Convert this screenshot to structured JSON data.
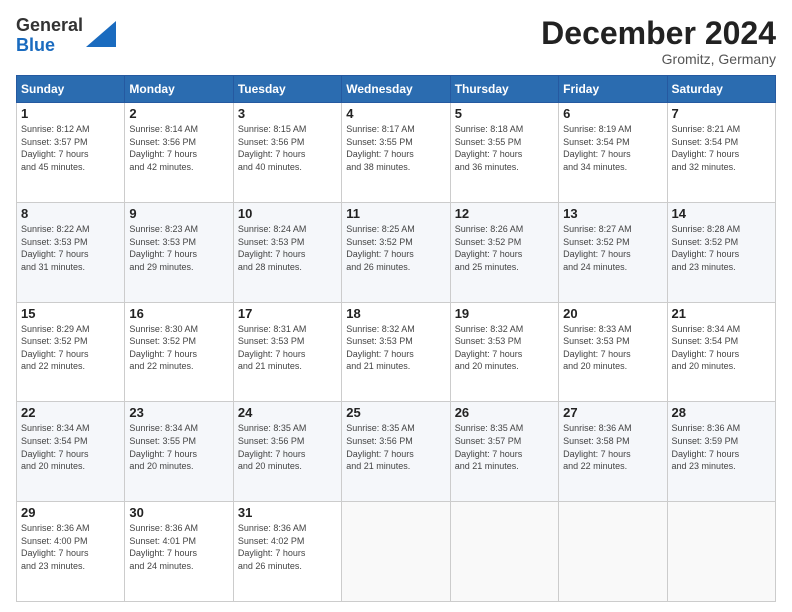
{
  "header": {
    "logo_line1": "General",
    "logo_line2": "Blue",
    "month_title": "December 2024",
    "location": "Gromitz, Germany"
  },
  "days_of_week": [
    "Sunday",
    "Monday",
    "Tuesday",
    "Wednesday",
    "Thursday",
    "Friday",
    "Saturday"
  ],
  "weeks": [
    [
      {
        "day": "1",
        "sunrise": "8:12 AM",
        "sunset": "3:57 PM",
        "daylight": "7 hours and 45 minutes."
      },
      {
        "day": "2",
        "sunrise": "8:14 AM",
        "sunset": "3:56 PM",
        "daylight": "7 hours and 42 minutes."
      },
      {
        "day": "3",
        "sunrise": "8:15 AM",
        "sunset": "3:56 PM",
        "daylight": "7 hours and 40 minutes."
      },
      {
        "day": "4",
        "sunrise": "8:17 AM",
        "sunset": "3:55 PM",
        "daylight": "7 hours and 38 minutes."
      },
      {
        "day": "5",
        "sunrise": "8:18 AM",
        "sunset": "3:55 PM",
        "daylight": "7 hours and 36 minutes."
      },
      {
        "day": "6",
        "sunrise": "8:19 AM",
        "sunset": "3:54 PM",
        "daylight": "7 hours and 34 minutes."
      },
      {
        "day": "7",
        "sunrise": "8:21 AM",
        "sunset": "3:54 PM",
        "daylight": "7 hours and 32 minutes."
      }
    ],
    [
      {
        "day": "8",
        "sunrise": "8:22 AM",
        "sunset": "3:53 PM",
        "daylight": "7 hours and 31 minutes."
      },
      {
        "day": "9",
        "sunrise": "8:23 AM",
        "sunset": "3:53 PM",
        "daylight": "7 hours and 29 minutes."
      },
      {
        "day": "10",
        "sunrise": "8:24 AM",
        "sunset": "3:53 PM",
        "daylight": "7 hours and 28 minutes."
      },
      {
        "day": "11",
        "sunrise": "8:25 AM",
        "sunset": "3:52 PM",
        "daylight": "7 hours and 26 minutes."
      },
      {
        "day": "12",
        "sunrise": "8:26 AM",
        "sunset": "3:52 PM",
        "daylight": "7 hours and 25 minutes."
      },
      {
        "day": "13",
        "sunrise": "8:27 AM",
        "sunset": "3:52 PM",
        "daylight": "7 hours and 24 minutes."
      },
      {
        "day": "14",
        "sunrise": "8:28 AM",
        "sunset": "3:52 PM",
        "daylight": "7 hours and 23 minutes."
      }
    ],
    [
      {
        "day": "15",
        "sunrise": "8:29 AM",
        "sunset": "3:52 PM",
        "daylight": "7 hours and 22 minutes."
      },
      {
        "day": "16",
        "sunrise": "8:30 AM",
        "sunset": "3:52 PM",
        "daylight": "7 hours and 22 minutes."
      },
      {
        "day": "17",
        "sunrise": "8:31 AM",
        "sunset": "3:53 PM",
        "daylight": "7 hours and 21 minutes."
      },
      {
        "day": "18",
        "sunrise": "8:32 AM",
        "sunset": "3:53 PM",
        "daylight": "7 hours and 21 minutes."
      },
      {
        "day": "19",
        "sunrise": "8:32 AM",
        "sunset": "3:53 PM",
        "daylight": "7 hours and 20 minutes."
      },
      {
        "day": "20",
        "sunrise": "8:33 AM",
        "sunset": "3:53 PM",
        "daylight": "7 hours and 20 minutes."
      },
      {
        "day": "21",
        "sunrise": "8:34 AM",
        "sunset": "3:54 PM",
        "daylight": "7 hours and 20 minutes."
      }
    ],
    [
      {
        "day": "22",
        "sunrise": "8:34 AM",
        "sunset": "3:54 PM",
        "daylight": "7 hours and 20 minutes."
      },
      {
        "day": "23",
        "sunrise": "8:34 AM",
        "sunset": "3:55 PM",
        "daylight": "7 hours and 20 minutes."
      },
      {
        "day": "24",
        "sunrise": "8:35 AM",
        "sunset": "3:56 PM",
        "daylight": "7 hours and 20 minutes."
      },
      {
        "day": "25",
        "sunrise": "8:35 AM",
        "sunset": "3:56 PM",
        "daylight": "7 hours and 21 minutes."
      },
      {
        "day": "26",
        "sunrise": "8:35 AM",
        "sunset": "3:57 PM",
        "daylight": "7 hours and 21 minutes."
      },
      {
        "day": "27",
        "sunrise": "8:36 AM",
        "sunset": "3:58 PM",
        "daylight": "7 hours and 22 minutes."
      },
      {
        "day": "28",
        "sunrise": "8:36 AM",
        "sunset": "3:59 PM",
        "daylight": "7 hours and 23 minutes."
      }
    ],
    [
      {
        "day": "29",
        "sunrise": "8:36 AM",
        "sunset": "4:00 PM",
        "daylight": "7 hours and 23 minutes."
      },
      {
        "day": "30",
        "sunrise": "8:36 AM",
        "sunset": "4:01 PM",
        "daylight": "7 hours and 24 minutes."
      },
      {
        "day": "31",
        "sunrise": "8:36 AM",
        "sunset": "4:02 PM",
        "daylight": "7 hours and 26 minutes."
      },
      null,
      null,
      null,
      null
    ]
  ]
}
